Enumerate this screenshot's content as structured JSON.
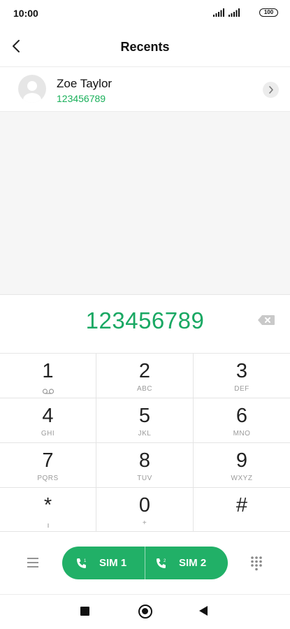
{
  "status_bar": {
    "time": "10:00",
    "battery": "100"
  },
  "header": {
    "title": "Recents"
  },
  "contact": {
    "name": "Zoe Taylor",
    "number": "123456789"
  },
  "dialer": {
    "number": "123456789"
  },
  "keypad": [
    {
      "digit": "1",
      "letters": ""
    },
    {
      "digit": "2",
      "letters": "ABC"
    },
    {
      "digit": "3",
      "letters": "DEF"
    },
    {
      "digit": "4",
      "letters": "GHI"
    },
    {
      "digit": "5",
      "letters": "JKL"
    },
    {
      "digit": "6",
      "letters": "MNO"
    },
    {
      "digit": "7",
      "letters": "PQRS"
    },
    {
      "digit": "8",
      "letters": "TUV"
    },
    {
      "digit": "9",
      "letters": "WXYZ"
    },
    {
      "digit": "*",
      "letters": ""
    },
    {
      "digit": "0",
      "letters": "+"
    },
    {
      "digit": "#",
      "letters": ""
    }
  ],
  "actions": {
    "sim1_label": "SIM 1",
    "sim2_label": "SIM 2"
  },
  "colors": {
    "accent": "#21b067",
    "number_green": "#19a863"
  }
}
